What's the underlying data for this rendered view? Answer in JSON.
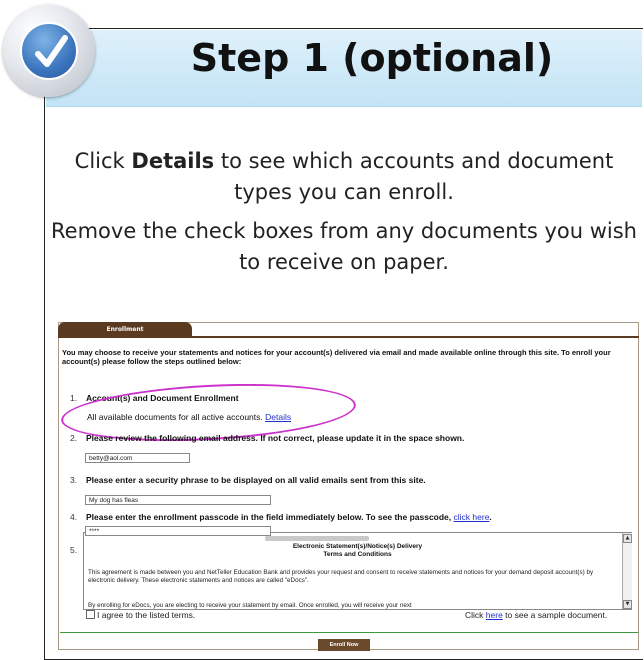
{
  "header": {
    "title": "Step 1 (optional)"
  },
  "intro": {
    "line1_pre": "Click ",
    "line1_bold": "Details",
    "line1_post": " to see which accounts and document types you can enroll.",
    "line2": "Remove the check boxes from any documents you wish to receive on paper."
  },
  "enrollment": {
    "tab_label": "Enrollment",
    "intro_text": "You may choose to receive your statements and notices for your account(s) delivered via email and made available online through this site. To enroll your account(s) please follow the steps outlined below:",
    "step1": {
      "number": "1.",
      "title": "Account(s) and Document Enrollment",
      "text": "All available documents for all active accounts.",
      "link": "Details"
    },
    "step2": {
      "number": "2.",
      "title": "Please review the following email address. If not correct, please update it in the space shown.",
      "value": "betty@aol.com"
    },
    "step3": {
      "number": "3.",
      "title": "Please enter a security phrase to be displayed on all valid emails sent from this site.",
      "value": "My dog has fleas"
    },
    "step4": {
      "number": "4.",
      "title": "Please enter the enrollment passcode in the field immediately below. To see the passcode,",
      "link": "click here",
      "suffix": ".",
      "value": "****"
    },
    "step5": {
      "number": "5.",
      "terms_title": "Electronic Statement(s)/Notice(s) Delivery",
      "terms_subtitle": "Terms and Conditions",
      "terms_p1": "This agreement is made between you and NetTeller Education Bank and provides your request and consent to receive statements and notices for your demand deposit account(s) by electronic delivery. These electronic statements and notices are called \"eDocs\".",
      "terms_p2": "By enrolling for eDocs, you are electing to receive your statement by email. Once enrolled, you will receive your next"
    },
    "agree_label": "I agree to the listed terms.",
    "sample_pre": "Click ",
    "sample_link": "here",
    "sample_post": " to see a sample document.",
    "enroll_button": "Enroll Now"
  },
  "colors": {
    "tab_brown": "#5a3b22",
    "highlight_oval": "#cc33cc",
    "link_blue": "#2230c8",
    "rule_green": "#3a9a3a"
  },
  "icons": {
    "badge": "checkmark-badge-icon"
  }
}
